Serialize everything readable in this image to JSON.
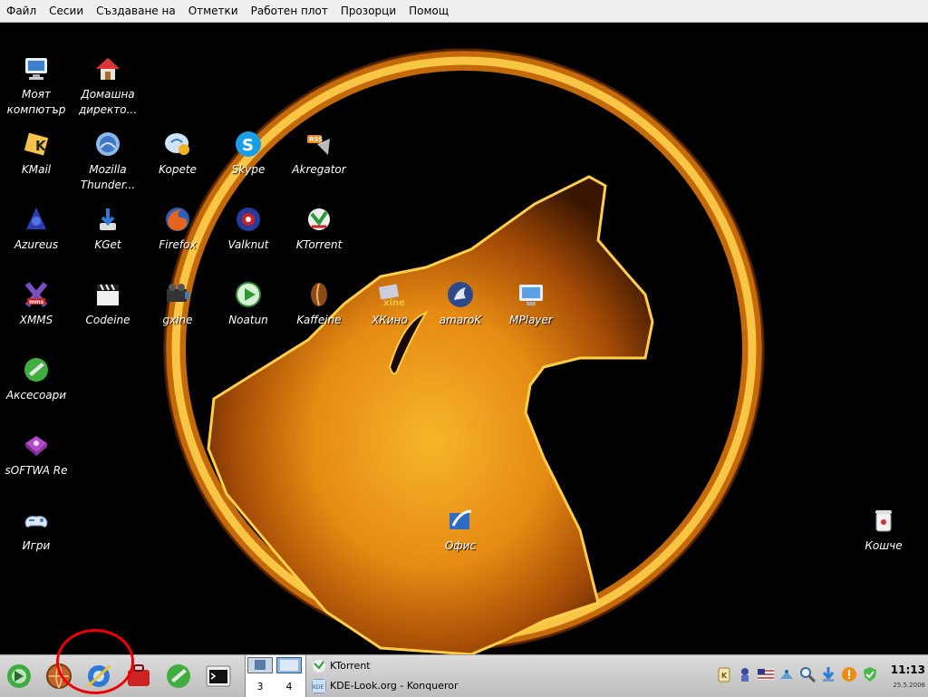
{
  "menubar": {
    "items": [
      "Файл",
      "Сесии",
      "Създаване на",
      "Отметки",
      "Работен плот",
      "Прозорци",
      "Помощ"
    ]
  },
  "desktop": {
    "icons": [
      {
        "id": "my-computer",
        "label": "Моят компютър",
        "icon": "computer-icon"
      },
      {
        "id": "home",
        "label": "Домашна директо...",
        "icon": "home-folder-icon"
      },
      {
        "id": "kmail",
        "label": "KMail",
        "icon": "kmail-icon"
      },
      {
        "id": "thunderbird",
        "label": "Mozilla Thunder...",
        "icon": "thunderbird-icon"
      },
      {
        "id": "kopete",
        "label": "Kopete",
        "icon": "kopete-icon"
      },
      {
        "id": "skype",
        "label": "Skype",
        "icon": "skype-icon"
      },
      {
        "id": "akregator",
        "label": "Akregator",
        "icon": "rss-icon"
      },
      {
        "id": "azureus",
        "label": "Azureus",
        "icon": "azureus-icon"
      },
      {
        "id": "kget",
        "label": "KGet",
        "icon": "kget-icon"
      },
      {
        "id": "firefox",
        "label": "Firefox",
        "icon": "firefox-icon"
      },
      {
        "id": "valknut",
        "label": "Valknut",
        "icon": "valknut-icon"
      },
      {
        "id": "ktorrent",
        "label": "KTorrent",
        "icon": "ktorrent-icon"
      },
      {
        "id": "xmms",
        "label": "XMMS",
        "icon": "xmms-icon"
      },
      {
        "id": "codeine",
        "label": "Codeine",
        "icon": "clapperboard-icon"
      },
      {
        "id": "gxine",
        "label": "gxine",
        "icon": "gxine-icon"
      },
      {
        "id": "noatun",
        "label": "Noatun",
        "icon": "play-icon"
      },
      {
        "id": "kaffeine",
        "label": "Kaffeine",
        "icon": "coffee-bean-icon"
      },
      {
        "id": "xkino",
        "label": "XКино",
        "icon": "xine-icon"
      },
      {
        "id": "amarok",
        "label": "amaroK",
        "icon": "amarok-icon"
      },
      {
        "id": "mplayer",
        "label": "MPlayer",
        "icon": "mplayer-icon"
      },
      {
        "id": "accessories",
        "label": "Аксесоари",
        "icon": "accessories-icon"
      },
      {
        "id": "software",
        "label": "sOFTWA Re",
        "icon": "debian-package-icon"
      },
      {
        "id": "games",
        "label": "Игри",
        "icon": "gamepad-icon"
      },
      {
        "id": "office",
        "label": "Офис",
        "icon": "office-icon"
      },
      {
        "id": "trash",
        "label": "Кошче",
        "icon": "trash-icon"
      }
    ]
  },
  "taskbar": {
    "quicklaunch": [
      {
        "id": "kmenu",
        "icon": "kmenu-icon"
      },
      {
        "id": "konqueror-web",
        "icon": "globe-icon"
      },
      {
        "id": "konqueror",
        "icon": "konqueror-icon"
      },
      {
        "id": "suitcase",
        "icon": "suitcase-icon"
      },
      {
        "id": "accessories",
        "icon": "accessories-icon"
      },
      {
        "id": "terminal",
        "icon": "terminal-icon"
      }
    ],
    "pager": {
      "desktops": [
        "3",
        "4"
      ]
    },
    "tasks": [
      {
        "label": "KTorrent",
        "icon": "ktorrent-icon"
      },
      {
        "label": "KDE-Look.org - Konqueror",
        "icon": "kde-look-icon"
      }
    ],
    "tray": [
      "klipper-icon",
      "robot-icon",
      "us-flag-icon",
      "network-icon",
      "search-icon",
      "download-icon",
      "alert-icon",
      "check-shield-icon"
    ],
    "clock": {
      "time": "11:13",
      "date": "25.5.2006"
    }
  },
  "colors": {
    "menubar": "#efefef",
    "taskbar": "#cfcfcf",
    "wallpaper_fire": "#f2a11a"
  }
}
